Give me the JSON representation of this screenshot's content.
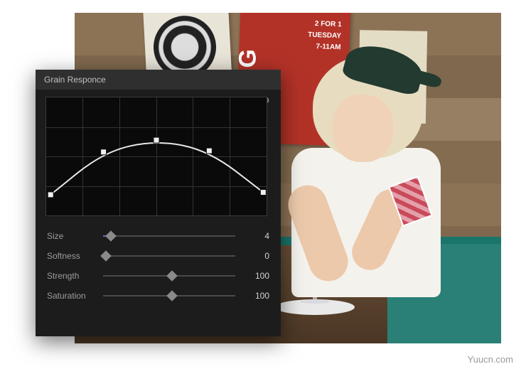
{
  "panel": {
    "title": "Grain Responce",
    "curve": {
      "points": [
        {
          "x": 0.02,
          "y": 0.82
        },
        {
          "x": 0.26,
          "y": 0.46
        },
        {
          "x": 0.5,
          "y": 0.36
        },
        {
          "x": 0.74,
          "y": 0.45
        },
        {
          "x": 0.985,
          "y": 0.8
        }
      ]
    }
  },
  "sliders": {
    "size": {
      "label": "Size",
      "value": "4",
      "pos": 0.06,
      "accent": true
    },
    "softness": {
      "label": "Softness",
      "value": "0",
      "pos": 0.02,
      "accent": false
    },
    "strength": {
      "label": "Strength",
      "value": "100",
      "pos": 0.52,
      "accent": false
    },
    "saturation": {
      "label": "Saturation",
      "value": "100",
      "pos": 0.52,
      "accent": false
    }
  },
  "poster": {
    "big": "BIG",
    "line1": "2 FOR 1",
    "line2": "TUESDAY",
    "line3": "7-11AM"
  },
  "watermark": "Yuucn.com"
}
